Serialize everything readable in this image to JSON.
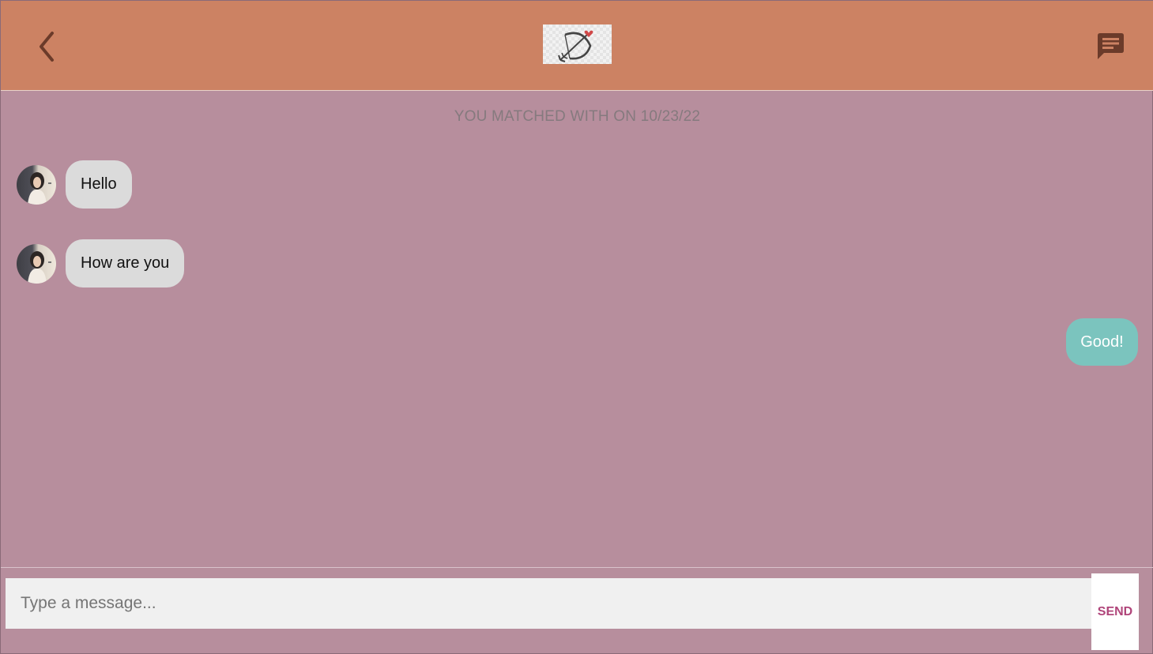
{
  "header": {
    "back_icon": "chevron-left-icon",
    "logo_icon": "cupid-bow-arrow-icon",
    "chat_icon": "chat-message-icon"
  },
  "conversation": {
    "matched_text": "YOU MATCHED WITH ON 10/23/22",
    "messages": [
      {
        "direction": "incoming",
        "text": "Hello"
      },
      {
        "direction": "incoming",
        "text": "How are you"
      },
      {
        "direction": "outgoing",
        "text": "Good!"
      }
    ]
  },
  "composer": {
    "input_value": "",
    "placeholder": "Type a message...",
    "send_label": "SEND"
  },
  "colors": {
    "header_bg": "#cc8263",
    "body_bg": "#b78e9d",
    "incoming_bubble": "#dbdbdb",
    "outgoing_bubble": "#7bc4be",
    "send_text": "#b0457a",
    "icon_dark": "#6b3b2a"
  }
}
